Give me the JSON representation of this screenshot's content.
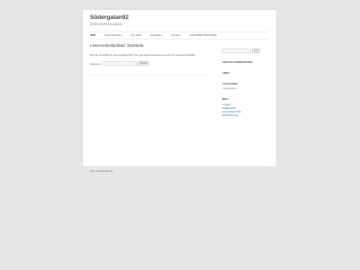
{
  "site": {
    "title": "Södergatan92",
    "description": "Ett till WordPress-nätverk"
  },
  "nav": {
    "items": [
      {
        "label": "Hem",
        "active": true
      },
      {
        "label": "Festivalinfo",
        "active": false
      },
      {
        "label": "Hit hem",
        "active": false
      },
      {
        "label": "Dalarna",
        "active": false
      },
      {
        "label": "Hotell",
        "active": false
      },
      {
        "label": "Samarbetspartner",
        "active": false
      }
    ]
  },
  "entry": {
    "title": "Lösenordsskyddad: Startsida",
    "text": "Det här innehållet är lösenordsskyddat. Var god ange ditt lösenord nedan för att visa innehållet.",
    "password_label": "Lösenord:",
    "submit_label": "Skicka"
  },
  "sidebar": {
    "search_button": "Sök",
    "widgets": [
      {
        "title": "Senaste kommentarer",
        "text": ""
      },
      {
        "title": "Arkiv",
        "text": ""
      },
      {
        "title": "Kategorier",
        "text": "Inga kategorier"
      },
      {
        "title": "Meta",
        "text": ""
      }
    ],
    "meta_links": [
      "Logga in",
      "Inläggs-RSS",
      "Kommentars-RSS",
      "WordPress.org"
    ]
  },
  "footer": {
    "text": "Drivs med WordPress"
  }
}
